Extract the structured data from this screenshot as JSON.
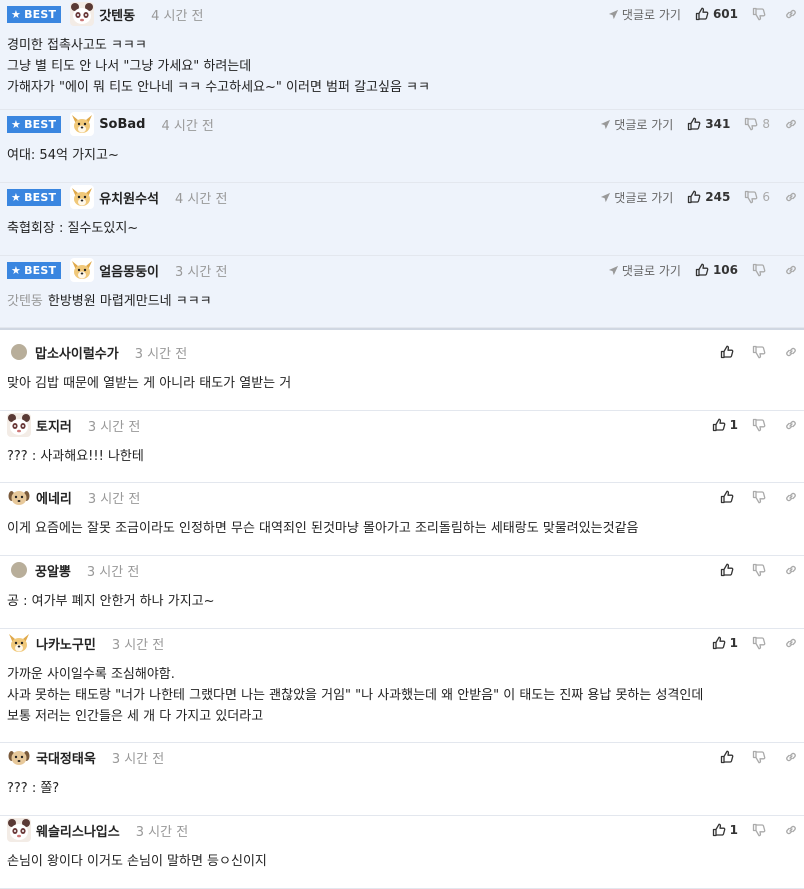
{
  "labels": {
    "best": "BEST",
    "reply": "댓글로 가기"
  },
  "best_comments": [
    {
      "nick": "갓텐동",
      "time": "4 시간 전",
      "likes": "601",
      "dislikes": "",
      "lines": [
        "경미한 접촉사고도 ㅋㅋㅋ",
        "그냥 별 티도 안 나서 \"그냥 가세요\" 하려는데",
        "가해자가 \"에이 뭐 티도 안나네 ㅋㅋ 수고하세요~\" 이러면 범퍼 갈고싶음 ㅋㅋ"
      ]
    },
    {
      "nick": "SoBad",
      "time": "4 시간 전",
      "likes": "341",
      "dislikes": "8",
      "lines": [
        "여대: 54억 가지고~"
      ]
    },
    {
      "nick": "유치원수석",
      "time": "4 시간 전",
      "likes": "245",
      "dislikes": "6",
      "lines": [
        "축협회장 : 질수도있지~"
      ]
    },
    {
      "nick": "얼음몽둥이",
      "time": "3 시간 전",
      "likes": "106",
      "dislikes": "",
      "mention": "갓텐동",
      "lines": [
        "한방병원 마렵게만드네 ㅋㅋㅋ"
      ]
    }
  ],
  "comments": [
    {
      "nick": "맙소사이럴수가",
      "time": "3 시간 전",
      "likes": "",
      "lines": [
        "맞아 김밥 때문에 열받는 게 아니라 태도가 열받는 거"
      ]
    },
    {
      "nick": "토지러",
      "time": "3 시간 전",
      "likes": "1",
      "lines": [
        "??? : 사과해요!!! 나한테"
      ]
    },
    {
      "nick": "에네리",
      "time": "3 시간 전",
      "likes": "",
      "lines": [
        "이게 요즘에는 잘못 조금이라도 인정하면 무슨 대역죄인 된것마냥 몰아가고 조리돌림하는 세태랑도 맞물려있는것같음"
      ]
    },
    {
      "nick": "꿍알뽕",
      "time": "3 시간 전",
      "likes": "",
      "lines": [
        "공 : 여가부 폐지 안한거 하나 가지고~"
      ]
    },
    {
      "nick": "나카노구민",
      "time": "3 시간 전",
      "likes": "1",
      "lines": [
        "가까운 사이일수록 조심해야함.",
        "사과 못하는 태도랑 \"너가 나한테 그랬다면 나는 괜찮았을 거임\" \"나 사과했는데 왜 안받음\" 이 태도는 진짜 용납 못하는 성격인데",
        "보통 저러는 인간들은 세 개 다 가지고 있더라고"
      ]
    },
    {
      "nick": "국대정태욱",
      "time": "3 시간 전",
      "likes": "",
      "lines": [
        "??? : 쫄?"
      ]
    },
    {
      "nick": "웨슬리스나입스",
      "time": "3 시간 전",
      "likes": "1",
      "lines": [
        "손님이 왕이다 이거도 손님이 말하면 등ㅇ신이지"
      ]
    }
  ]
}
